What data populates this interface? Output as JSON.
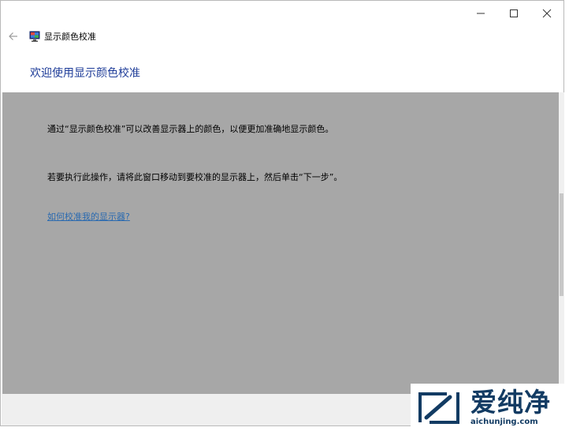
{
  "window": {
    "app_title": "显示颜色校准",
    "icons": {
      "back": "back-arrow-icon",
      "app": "monitor-icon",
      "minimize": "minimize-icon",
      "maximize": "maximize-icon",
      "close": "close-icon"
    }
  },
  "page": {
    "heading": "欢迎使用显示颜色校准",
    "paragraph1": "通过“显示颜色校准”可以改善显示器上的颜色，以便更加准确地显示颜色。",
    "paragraph2": "若要执行此操作，请将此窗口移动到要校准的显示器上，然后单击“下一步”。",
    "help_link": "如何校准我的显示器?"
  },
  "watermark": {
    "brand_cn": "爱纯净",
    "brand_url": "aichunjing.com"
  },
  "colors": {
    "heading": "#1f3d99",
    "link": "#2a6ab0",
    "content_bg": "#a7a7a7",
    "brand": "#123b63"
  }
}
